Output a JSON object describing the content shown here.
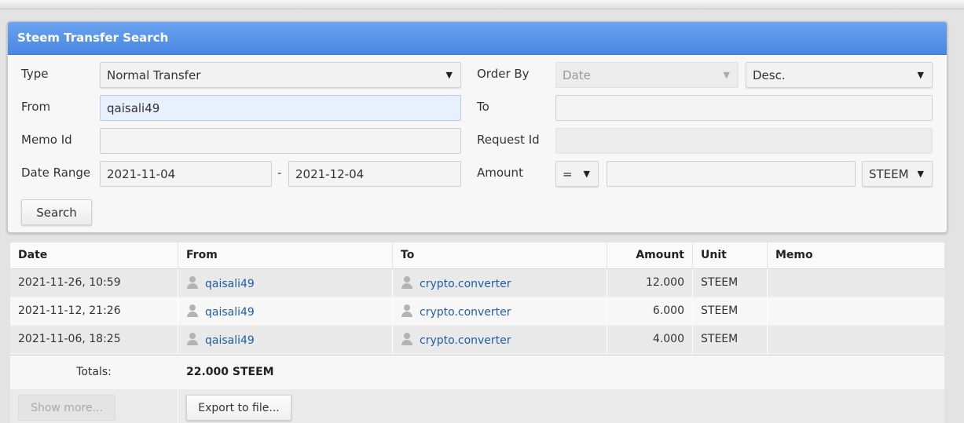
{
  "panel": {
    "title": "Steem Transfer Search"
  },
  "form": {
    "type": {
      "label": "Type",
      "value": "Normal Transfer"
    },
    "order_by": {
      "label": "Order By",
      "field_value": "Date",
      "direction_value": "Desc."
    },
    "from": {
      "label": "From",
      "value": "qaisali49"
    },
    "to": {
      "label": "To",
      "value": ""
    },
    "memo_id": {
      "label": "Memo Id",
      "value": ""
    },
    "request_id": {
      "label": "Request Id",
      "value": ""
    },
    "date_range": {
      "label": "Date Range",
      "start": "2021-11-04",
      "separator": "-",
      "end": "2021-12-04"
    },
    "amount": {
      "label": "Amount",
      "operator": "=",
      "value": "",
      "unit": "STEEM"
    },
    "search_button": "Search"
  },
  "icons": {
    "dropdown": "triangle-down-icon",
    "user": "user-icon"
  },
  "table": {
    "headers": {
      "date": "Date",
      "from": "From",
      "to": "To",
      "amount": "Amount",
      "unit": "Unit",
      "memo": "Memo"
    },
    "rows": [
      {
        "date": "2021-11-26, 10:59",
        "from": "qaisali49",
        "to": "crypto.converter",
        "amount": "12.000",
        "unit": "STEEM",
        "memo": ""
      },
      {
        "date": "2021-11-12, 21:26",
        "from": "qaisali49",
        "to": "crypto.converter",
        "amount": "6.000",
        "unit": "STEEM",
        "memo": ""
      },
      {
        "date": "2021-11-06, 18:25",
        "from": "qaisali49",
        "to": "crypto.converter",
        "amount": "4.000",
        "unit": "STEEM",
        "memo": ""
      }
    ],
    "totals_label": "Totals:",
    "totals_value": "22.000 STEEM",
    "show_more": "Show more...",
    "export": "Export to file..."
  },
  "colors": {
    "header_blue": "#4a86e3",
    "link": "#1d5ea8"
  }
}
